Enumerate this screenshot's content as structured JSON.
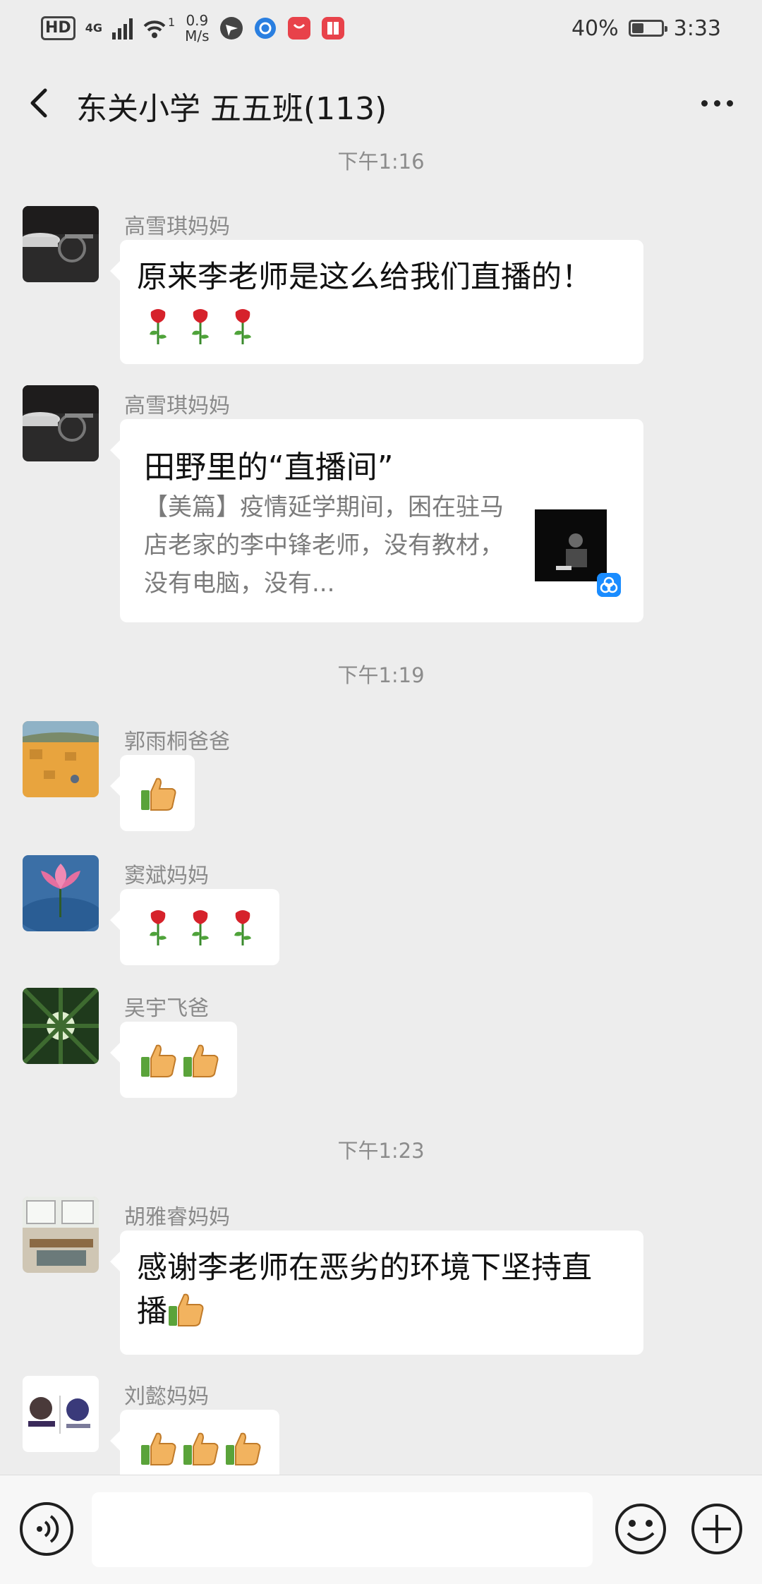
{
  "status_bar": {
    "hd": "HD",
    "network": "4G",
    "signal_level": 4,
    "data_speed_value": "0.9",
    "data_speed_unit": "M/s",
    "battery_text": "40%",
    "battery_level": 0.4,
    "time": "3:33",
    "wifi_count": "1"
  },
  "header": {
    "title": "东关小学 五五班(113)"
  },
  "chat": {
    "timestamps": [
      "下午1:16",
      "下午1:19",
      "下午1:23"
    ],
    "messages": [
      {
        "sender": "高雪琪妈妈",
        "text": "原来李老师是这么给我们直播的！",
        "emojis": [
          "rose-icon",
          "rose-icon",
          "rose-icon"
        ]
      },
      {
        "sender": "高雪琪妈妈",
        "card": {
          "title": "田野里的“直播间”",
          "desc": "【美篇】疫情延学期间，困在驻马店老家的李中锋老师，没有教材，没有电脑，没有..."
        }
      },
      {
        "sender": "郭雨桐爸爸",
        "emojis": [
          "thumbs-up-icon"
        ]
      },
      {
        "sender": "窦斌妈妈",
        "emojis": [
          "rose-icon",
          "rose-icon",
          "rose-icon"
        ]
      },
      {
        "sender": "吴宇飞爸",
        "emojis": [
          "thumbs-up-icon",
          "thumbs-up-icon"
        ]
      },
      {
        "sender": "胡雅睿妈妈",
        "text_line1": "感谢李老师在恶劣的环境下坚持直",
        "text_line2": "播",
        "emojis": [
          "thumbs-up-icon"
        ]
      },
      {
        "sender": "刘懿妈妈",
        "emojis": [
          "thumbs-up-icon",
          "thumbs-up-icon",
          "thumbs-up-icon"
        ]
      }
    ]
  },
  "input_bar": {
    "value": "",
    "icons": [
      "voice-icon",
      "emoji-face-icon",
      "plus-icon"
    ]
  },
  "colors": {
    "background": "#ededed",
    "bubble": "#ffffff",
    "sender": "#8a8a8a",
    "timestamp": "#8c8c8c"
  }
}
